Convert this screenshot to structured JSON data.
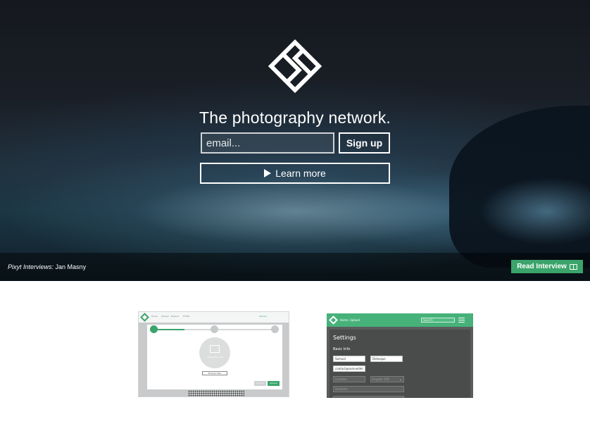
{
  "hero": {
    "tagline": "The photography network.",
    "email_placeholder": "email...",
    "signup_label": "Sign up",
    "learn_more_label": "Learn more",
    "credit_prefix": "Pixyt Interviews:",
    "credit_name": "Jan Masny",
    "read_interview_label": "Read Interview",
    "accent_color": "#3aa46a"
  },
  "thumb_upload": {
    "nav": [
      "Home",
      "Upload",
      "Explore",
      "Profile"
    ],
    "upload_link": "Upload",
    "drag_text": "Drag files here",
    "browse_label": "Browse files",
    "cancel_label": "Cancel",
    "next_label": "Upload"
  },
  "thumb_settings": {
    "nav_home": "Home",
    "nav_upload": "Upload",
    "search_placeholder": "Search",
    "title": "Settings",
    "section": "Basic Info",
    "first_name": "Samuel",
    "last_name": "Delesque",
    "email": "contact@samueldel",
    "location": "Location",
    "language": "English (UK)",
    "headline": "Headline"
  }
}
